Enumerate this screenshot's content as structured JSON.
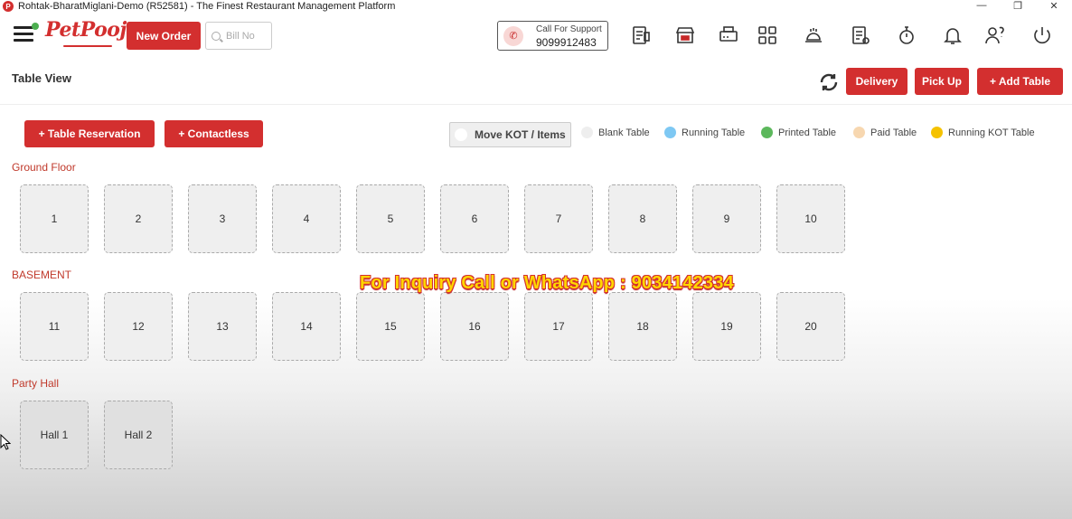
{
  "window": {
    "title": "Rohtak-BharatMiglani-Demo (R52581) - The Finest Restaurant Management Platform",
    "logo_letter": "P",
    "minimize": "—",
    "restore": "❐",
    "close": "✕"
  },
  "header": {
    "brand": "PetPooja",
    "new_order": "New Order",
    "bill_placeholder": "Bill No",
    "support_label": "Call For Support",
    "support_phone": "9099912483",
    "icons": [
      "billing-icon",
      "store-icon",
      "printer-icon",
      "grid-icon",
      "kitchen-display-icon",
      "report-icon",
      "timer-icon",
      "bell-icon",
      "help-user-icon",
      "power-icon"
    ]
  },
  "subheader": {
    "title": "Table View",
    "delivery": "Delivery",
    "pickup": "Pick Up",
    "add_table": "+ Add Table"
  },
  "actions": {
    "reservation": "+ Table Reservation",
    "contactless": "+ Contactless",
    "move_kot": "Move KOT / Items"
  },
  "legend": [
    {
      "label": "Blank Table",
      "color": "#eeeeee"
    },
    {
      "label": "Running Table",
      "color": "#7ec8f3"
    },
    {
      "label": "Printed Table",
      "color": "#5cb85c"
    },
    {
      "label": "Paid Table",
      "color": "#f7d7b0"
    },
    {
      "label": "Running KOT Table",
      "color": "#f5c200"
    }
  ],
  "sections": [
    {
      "name": "Ground Floor",
      "tables": [
        "1",
        "2",
        "3",
        "4",
        "5",
        "6",
        "7",
        "8",
        "9",
        "10"
      ]
    },
    {
      "name": "BASEMENT",
      "tables": [
        "11",
        "12",
        "13",
        "14",
        "15",
        "16",
        "17",
        "18",
        "19",
        "20"
      ]
    },
    {
      "name": "Party Hall",
      "tables": [
        "Hall 1",
        "Hall 2"
      ]
    }
  ],
  "overlay": {
    "promo": "For Inquiry Call or WhatsApp : 9034142334"
  },
  "colors": {
    "brand_red": "#d32f2f",
    "section_label": "#c0392b"
  }
}
